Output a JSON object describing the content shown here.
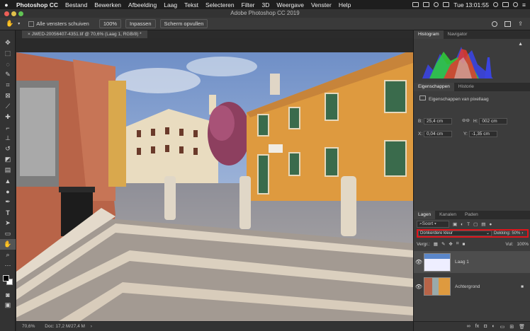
{
  "menubar": {
    "apple": "",
    "app_name": "Photoshop CC",
    "items": [
      "Bestand",
      "Bewerken",
      "Afbeelding",
      "Laag",
      "Tekst",
      "Selecteren",
      "Filter",
      "3D",
      "Weergave",
      "Venster",
      "Help"
    ],
    "clock": "Tue 13:01:55"
  },
  "window": {
    "title": "Adobe Photoshop CC 2019"
  },
  "options_bar": {
    "checkbox_label": "Alle vensters schuiven",
    "zoom_button": "100%",
    "fit_button": "Inpassen",
    "fill_button": "Scherm opvullen"
  },
  "document": {
    "tab_label": "JWED-20056407-4351.tif @ 70,6% (Laag 1, RGB/8) *",
    "status_zoom": "70,6%",
    "status_doc": "Doc: 17,2 M/27,4 M"
  },
  "panels": {
    "histogram_tabs": [
      "Histogram",
      "Navigator"
    ],
    "properties_tabs": [
      "Eigenschappen",
      "Historie"
    ],
    "properties_title": "Eigenschappen van pixellaag",
    "w_label": "B:",
    "w_value": "25,4 cm",
    "h_label": "H:",
    "h_value": "002 cm",
    "x_label": "X:",
    "x_value": "0,04 cm",
    "y_label": "Y:",
    "y_value": "-1,35 cm",
    "layers_tabs": [
      "Lagen",
      "Kanalen",
      "Paden"
    ],
    "filter_label": "Soort",
    "blend_mode": "Donkerdere kleur",
    "opacity_label": "Dekking:",
    "opacity_value": "50%",
    "lock_label": "Vergr.:",
    "fill_label": "Vul:",
    "fill_value": "100%",
    "layers": [
      {
        "name": "Laag 1"
      },
      {
        "name": "Achtergrond"
      }
    ]
  },
  "colors": {
    "highlight": "#e0141b",
    "selected_layer": "#4d4d4d"
  }
}
